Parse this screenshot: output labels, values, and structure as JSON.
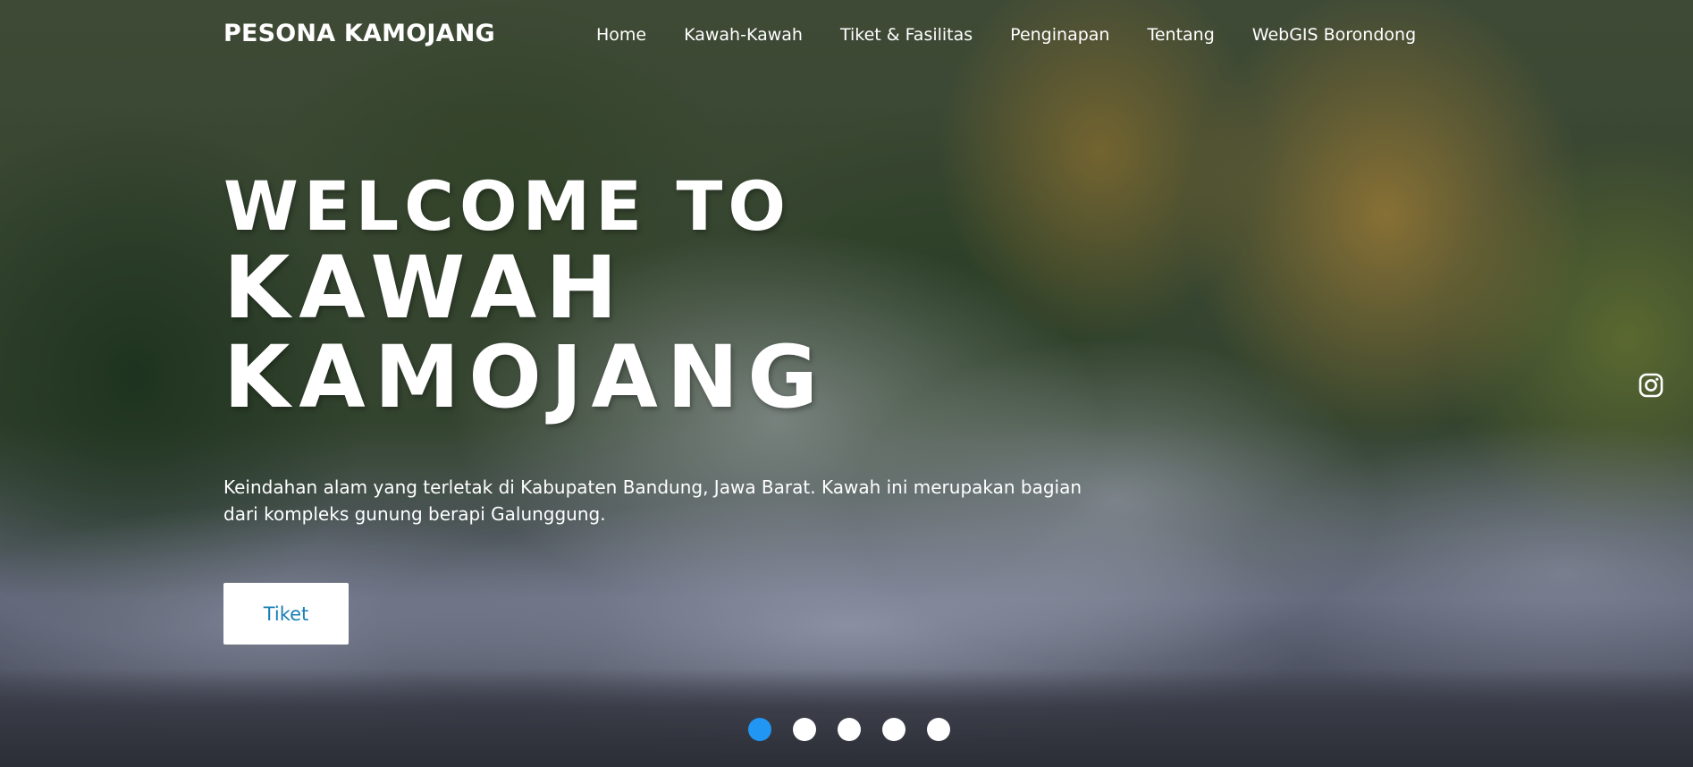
{
  "navbar": {
    "brand": "PESONA KAMOJANG",
    "links": [
      {
        "label": "Home"
      },
      {
        "label": "Kawah-Kawah"
      },
      {
        "label": "Tiket & Fasilitas"
      },
      {
        "label": "Penginapan"
      },
      {
        "label": "Tentang"
      },
      {
        "label": "WebGIS Borondong"
      }
    ]
  },
  "hero": {
    "title_line1": "WELCOME TO",
    "title_line2": "KAWAH",
    "title_line3": "KAMOJANG",
    "description": "Keindahan alam yang terletak di Kabupaten Bandung, Jawa Barat. Kawah ini merupakan bagian dari kompleks gunung berapi Galunggung.",
    "cta_label": "Tiket"
  },
  "social": {
    "icon": "instagram-icon"
  },
  "carousel": {
    "slide_count": 5,
    "active_index": 0
  },
  "colors": {
    "cta_text": "#1a7fb3",
    "active_dot": "#2196f3",
    "text": "#ffffff"
  }
}
